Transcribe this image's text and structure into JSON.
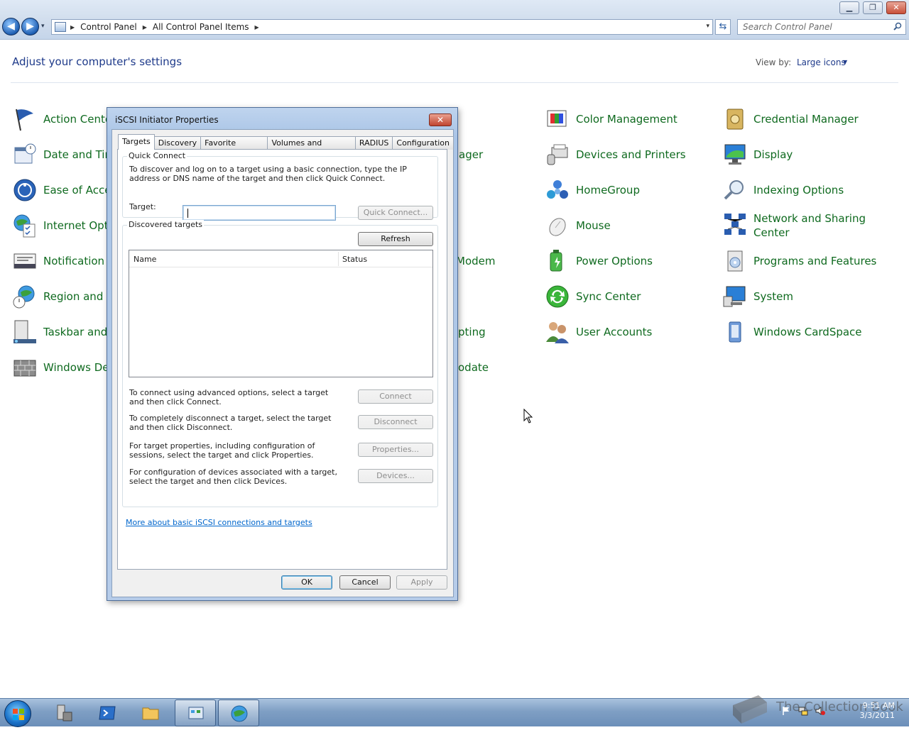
{
  "window": {
    "min_glyph": "▁",
    "max_glyph": "❐",
    "close_glyph": "✕"
  },
  "nav": {
    "back_glyph": "◀",
    "forward_glyph": "▶",
    "dropdown_glyph": "▾",
    "breadcrumbs": [
      "Control Panel",
      "All Control Panel Items"
    ],
    "crumb_sep": "▶",
    "search_placeholder": "Search Control Panel"
  },
  "header": {
    "heading": "Adjust your computer's settings",
    "view_by_label": "View by:",
    "view_by_value": "Large icons",
    "view_by_caret": "▼"
  },
  "items": {
    "col1": [
      "Action Cente",
      "Date and Tim",
      "Ease of Acces",
      "Internet Opti",
      "Notification A",
      "Region and L",
      "Taskbar and",
      "Windows De"
    ],
    "col3_partial": [
      "ager",
      "Modem",
      "pting",
      "odate"
    ],
    "col4": [
      "Color Management",
      "Devices and Printers",
      "HomeGroup",
      "Mouse",
      "Power Options",
      "Sync Center",
      "User Accounts"
    ],
    "col5": [
      "Credential Manager",
      "Display",
      "Indexing Options",
      "Network and Sharing Center",
      "Programs and Features",
      "System",
      "Windows CardSpace"
    ]
  },
  "dialog": {
    "title": "iSCSI Initiator Properties",
    "close_glyph": "✕",
    "tabs": [
      "Targets",
      "Discovery",
      "Favorite Targets",
      "Volumes and Devices",
      "RADIUS",
      "Configuration"
    ],
    "quick_connect": {
      "legend": "Quick Connect",
      "description": "To discover and log on to a target using a basic connection, type the IP address or DNS name of the target and then click Quick Connect.",
      "target_label": "Target:",
      "target_value": "",
      "button": "Quick Connect..."
    },
    "discovered": {
      "legend": "Discovered targets",
      "refresh": "Refresh",
      "columns": [
        "Name",
        "Status"
      ],
      "rows": []
    },
    "actions": [
      {
        "text": "To connect using advanced options, select a target and then click Connect.",
        "button": "Connect"
      },
      {
        "text": "To completely disconnect a target, select the target and then click Disconnect.",
        "button": "Disconnect"
      },
      {
        "text": "For target properties, including configuration of sessions, select the target and click Properties.",
        "button": "Properties..."
      },
      {
        "text": "For configuration of devices associated with a target, select the target and then click Devices.",
        "button": "Devices..."
      }
    ],
    "link": "More about basic iSCSI connections and targets",
    "ok": "OK",
    "cancel": "Cancel",
    "apply": "Apply"
  },
  "taskbar": {
    "watermark": "The Collection Book",
    "time": "9:51 AM",
    "date": "3/3/2011"
  },
  "colors": {
    "link_green": "#0f6a1f",
    "heading_blue": "#1e3a8a",
    "link_blue": "#0066cc"
  }
}
